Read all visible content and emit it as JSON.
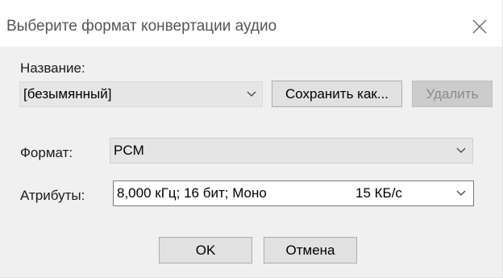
{
  "dialog": {
    "title": "Выберите формат конвертации аудио",
    "close_icon": "close-icon"
  },
  "name_section": {
    "label": "Название:",
    "preset_value": "[безымянный]",
    "save_as_label": "Сохранить как...",
    "delete_label": "Удалить",
    "delete_enabled": false
  },
  "format": {
    "label": "Формат:",
    "value": "PCM"
  },
  "attributes": {
    "label": "Атрибуты:",
    "value": "8,000 кГц; 16 бит; Моно",
    "rate": "15 КБ/с"
  },
  "buttons": {
    "ok_label": "OK",
    "cancel_label": "Отмена"
  },
  "colors": {
    "dialog_background": "#f0f0f0",
    "titlebar_background": "#ffffff",
    "button_face": "#e1e1e1",
    "disabled_button_face": "#cccccc",
    "disabled_text": "#8a8a8a"
  }
}
